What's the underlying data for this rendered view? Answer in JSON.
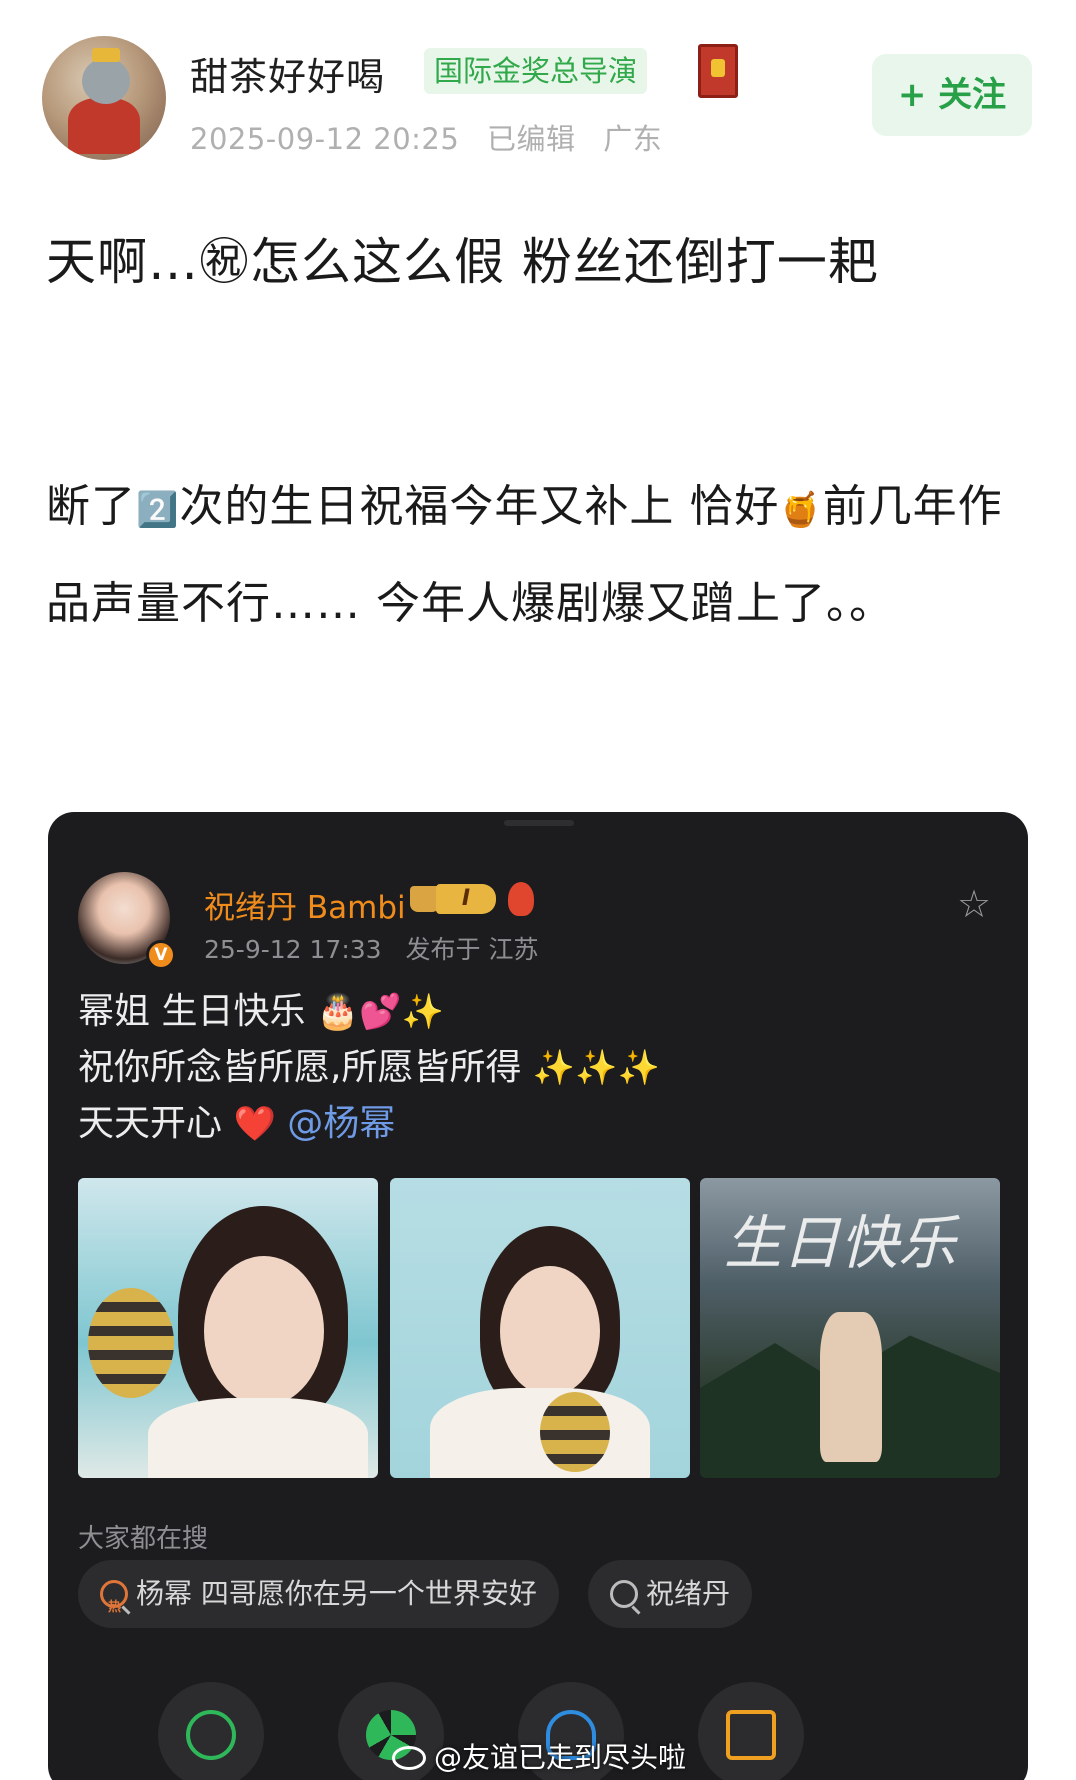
{
  "header": {
    "username": "甜茶好好喝",
    "title_badge": "国际金奖总导演",
    "timestamp": "2025-09-12 20:25",
    "edited": "已编辑",
    "location": "广东",
    "follow_label": "+ 关注",
    "colors": {
      "follow_bg": "#e9f6ec",
      "follow_text": "#27a048",
      "badge_text": "#31a84a"
    }
  },
  "post": {
    "paragraph_1": "天啊…㊗怎么这么假 粉丝还倒打一耙",
    "paragraph_2_a": "断了",
    "paragraph_2_number": "2️⃣",
    "paragraph_2_b": "次的生日祝福今年又补上 恰好",
    "paragraph_2_emoji": "🍯",
    "paragraph_2_c": "前几年作品声量不行…… 今年人爆剧爆又蹭上了。。"
  },
  "embedded": {
    "author": "祝绪丹 Bambi",
    "vip_level": "I",
    "timestamp": "25-9-12 17:33",
    "published_at": "发布于 江苏",
    "line_1": "幂姐 生日快乐",
    "line_1_emoji": "🎂💕✨",
    "line_2": "祝你所念皆所愿,所愿皆所得",
    "line_2_emoji": "✨✨✨",
    "line_3": "天天开心",
    "line_3_emoji": "❤️",
    "mention": "@杨幂",
    "photo_3_caption": "生日快乐",
    "search_label": "大家都在搜",
    "hot_tag": "热",
    "search_chips": [
      "杨幂 四哥愿你在另一个世界安好",
      "祝绪丹"
    ],
    "icons": [
      "star-icon",
      "wechat-icon",
      "moments-icon",
      "qq-icon",
      "save-image-icon"
    ]
  },
  "watermark": "@友谊已走到尽头啦"
}
